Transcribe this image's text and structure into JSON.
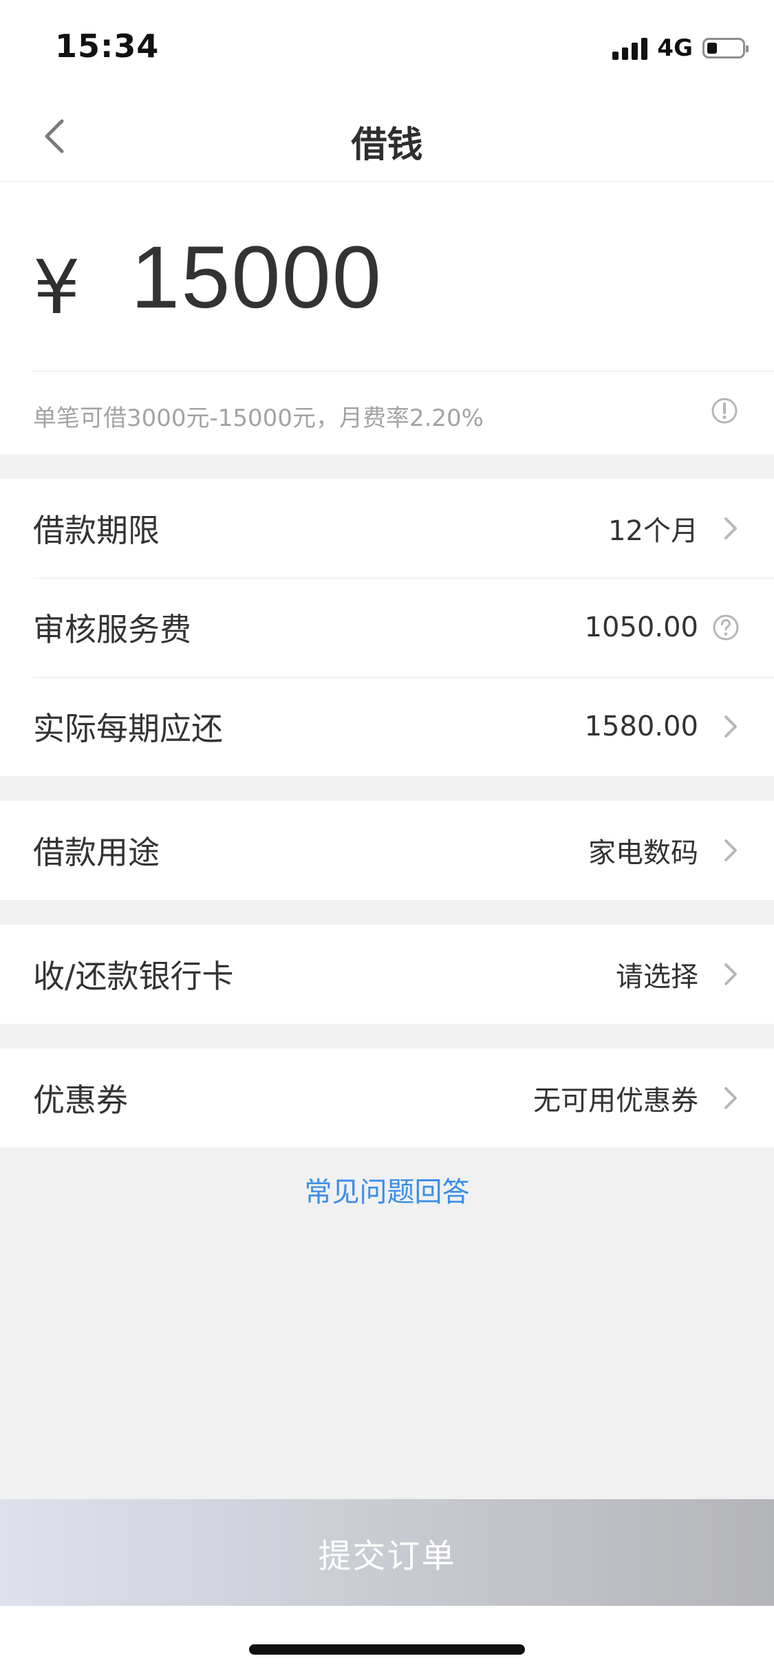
{
  "status_bar": {
    "time": "15:34",
    "network": "4G"
  },
  "nav": {
    "title": "借钱",
    "back_icon": "chevron-left-icon"
  },
  "amount": {
    "currency": "¥",
    "value": "15000",
    "hint": "单笔可借3000元-15000元，月费率2.20%",
    "hint_icon": "info-icon"
  },
  "loan_details": [
    {
      "label": "借款期限",
      "value": "12个月",
      "icon": "chevron-right-icon"
    },
    {
      "label": "审核服务费",
      "value": "1050.00",
      "icon": "question-icon"
    },
    {
      "label": "实际每期应还",
      "value": "1580.00",
      "icon": "chevron-right-icon"
    }
  ],
  "purpose": {
    "label": "借款用途",
    "value": "家电数码",
    "icon": "chevron-right-icon"
  },
  "bank_card": {
    "label": "收/还款银行卡",
    "value": "请选择",
    "icon": "chevron-right-icon"
  },
  "coupon": {
    "label": "优惠券",
    "value": "无可用优惠券",
    "icon": "chevron-right-icon"
  },
  "faq_link": "常见问题回答",
  "submit_label": "提交订单",
  "colors": {
    "link": "#3a8ee8",
    "page_bg": "#f1f1f1",
    "hint_text": "#a3a3a3",
    "button_gradient_start": "#dee1ec",
    "button_gradient_end": "#b4b5b9"
  }
}
